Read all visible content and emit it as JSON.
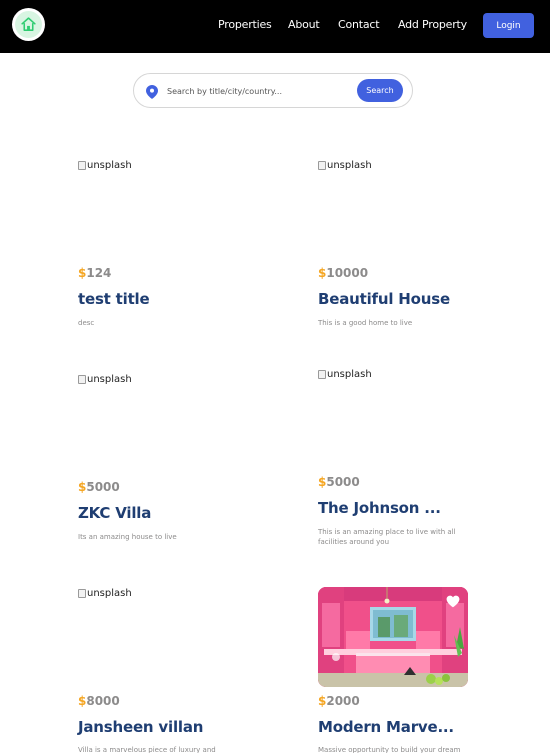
{
  "nav": {
    "links": [
      "Properties",
      "About",
      "Contact",
      "Add Property"
    ],
    "login_label": "Login"
  },
  "search": {
    "placeholder": "Search by title/city/country...",
    "button_label": "Search"
  },
  "cards": [
    {
      "img_alt": "unsplash",
      "currency": "$",
      "price": "124",
      "title": "test title",
      "desc": "desc"
    },
    {
      "img_alt": "unsplash",
      "currency": "$",
      "price": "10000",
      "title": "Beautiful House",
      "desc": "This is a good home to live"
    },
    {
      "img_alt": "unsplash",
      "currency": "$",
      "price": "5000",
      "title": "ZKC Villa",
      "desc": "Its an amazing house to live"
    },
    {
      "img_alt": "unsplash",
      "currency": "$",
      "price": "5000",
      "title": "The Johnson ...",
      "desc": "This is an amazing place to live with all facilities around you"
    },
    {
      "img_alt": "unsplash",
      "currency": "$",
      "price": "8000",
      "title": "Jansheen villan",
      "desc": "Villa is a marvelous piece of luxury and Art."
    },
    {
      "currency": "$",
      "price": "2000",
      "title": "Modern Marve...",
      "desc": "Massive opportunity to build your dream"
    }
  ],
  "colors": {
    "accent": "#4161df",
    "title": "#1f3e72",
    "dollar": "#f5a623",
    "muted": "#8c8b8b"
  },
  "icons": {
    "logo": "house-icon",
    "search": "location-pin-icon",
    "favorite": "heart-icon"
  }
}
